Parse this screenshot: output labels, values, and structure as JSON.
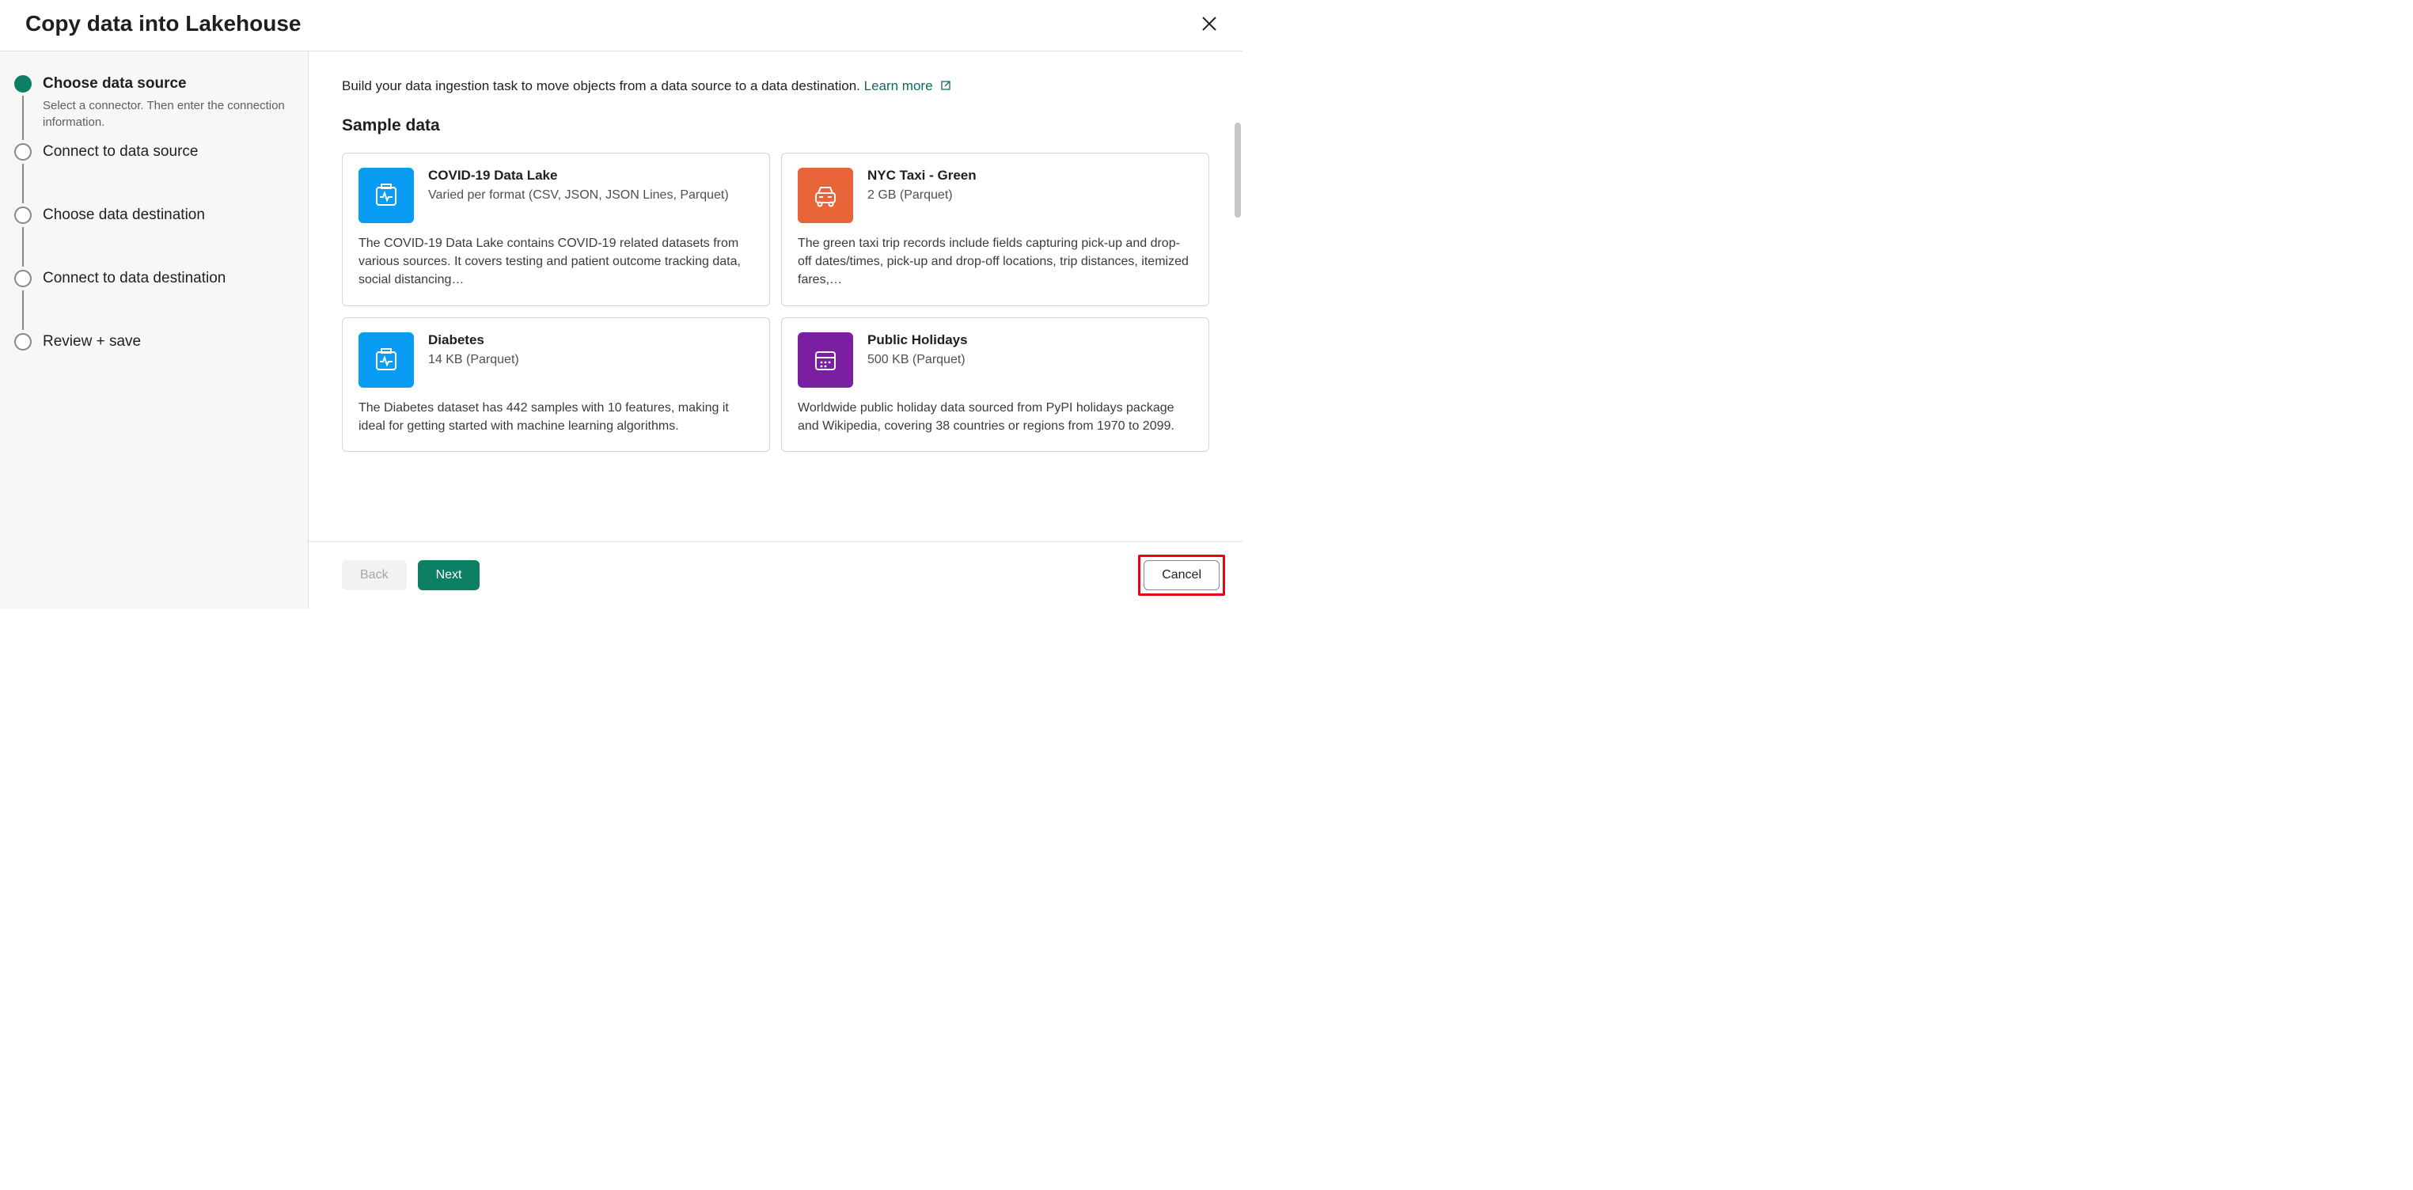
{
  "header": {
    "title": "Copy data into Lakehouse"
  },
  "steps": [
    {
      "title": "Choose data source",
      "description": "Select a connector. Then enter the connection information.",
      "active": true
    },
    {
      "title": "Connect to data source",
      "description": "",
      "active": false
    },
    {
      "title": "Choose data destination",
      "description": "",
      "active": false
    },
    {
      "title": "Connect to data destination",
      "description": "",
      "active": false
    },
    {
      "title": "Review + save",
      "description": "",
      "active": false
    }
  ],
  "intro": {
    "text": "Build your data ingestion task to move objects from a data source to a data destination. ",
    "learn_more": "Learn more"
  },
  "section_title": "Sample data",
  "cards": [
    {
      "icon": "health-pulse-icon",
      "icon_color": "blue",
      "title": "COVID-19 Data Lake",
      "subtitle": "Varied per format (CSV, JSON, JSON Lines, Parquet)",
      "description": "The COVID-19 Data Lake contains COVID-19 related datasets from various sources. It covers testing and patient outcome tracking data, social distancing…"
    },
    {
      "icon": "taxi-icon",
      "icon_color": "orange",
      "title": "NYC Taxi - Green",
      "subtitle": "2 GB (Parquet)",
      "description": "The green taxi trip records include fields capturing pick-up and drop-off dates/times, pick-up and drop-off locations, trip distances, itemized fares,…"
    },
    {
      "icon": "health-pulse-icon",
      "icon_color": "blue",
      "title": "Diabetes",
      "subtitle": "14 KB (Parquet)",
      "description": "The Diabetes dataset has 442 samples with 10 features, making it ideal for getting started with machine learning algorithms."
    },
    {
      "icon": "calendar-icon",
      "icon_color": "purple",
      "title": "Public Holidays",
      "subtitle": "500 KB (Parquet)",
      "description": "Worldwide public holiday data sourced from PyPI holidays package and Wikipedia, covering 38 countries or regions from 1970 to 2099."
    }
  ],
  "footer": {
    "back": "Back",
    "next": "Next",
    "cancel": "Cancel"
  }
}
